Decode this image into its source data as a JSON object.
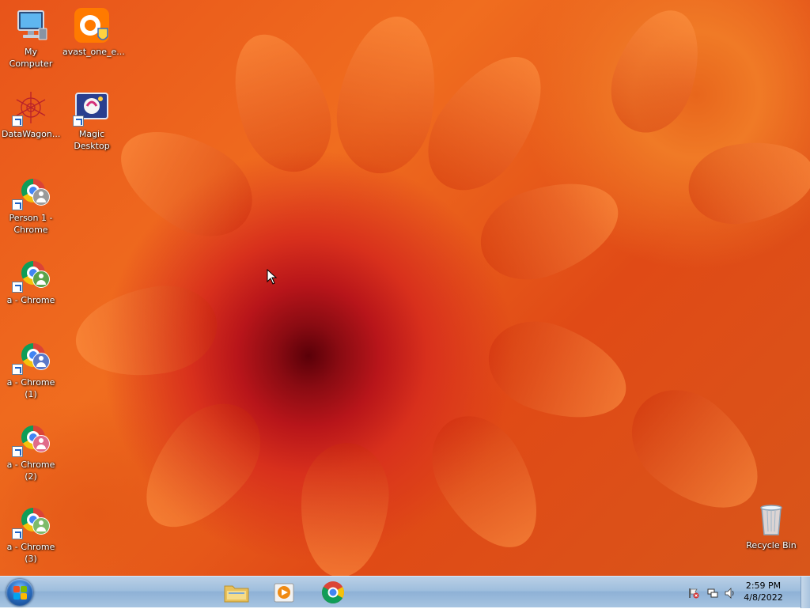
{
  "desktop_icons": [
    {
      "name": "my-computer",
      "label": "My Computer",
      "icon": "monitor-icon"
    },
    {
      "name": "avast-one",
      "label": "avast_one_e...",
      "icon": "avast-icon"
    },
    {
      "name": "datawagon",
      "label": "DataWagon...",
      "icon": "datawagon-icon"
    },
    {
      "name": "magic-desktop",
      "label": "Magic Desktop",
      "icon": "magic-desktop-icon"
    },
    {
      "name": "person1-chrome",
      "label": "Person 1 - Chrome",
      "icon": "chrome-icon"
    },
    {
      "name": "a-chrome",
      "label": "a - Chrome",
      "icon": "chrome-icon"
    },
    {
      "name": "a-chrome-1",
      "label": "a - Chrome (1)",
      "icon": "chrome-icon"
    },
    {
      "name": "a-chrome-2",
      "label": "a - Chrome (2)",
      "icon": "chrome-icon"
    },
    {
      "name": "a-chrome-3",
      "label": "a - Chrome (3)",
      "icon": "chrome-icon"
    },
    {
      "name": "recycle-bin",
      "label": "Recycle Bin",
      "icon": "recycle-bin-icon"
    }
  ],
  "taskbar": {
    "start": {
      "icon": "windows-logo-icon"
    },
    "pinned": [
      {
        "name": "explorer",
        "icon": "folder-icon"
      },
      {
        "name": "media-player",
        "icon": "media-player-icon"
      },
      {
        "name": "chrome",
        "icon": "chrome-icon"
      }
    ],
    "tray": {
      "icons": [
        "action-center-flag-icon",
        "network-icon",
        "volume-icon"
      ],
      "time": "2:59 PM",
      "date": "4/8/2022"
    }
  },
  "colors": {
    "taskbar": "#a7c4e1",
    "badge_gray": "#9a9a9a",
    "badge_green": "#5aa34a",
    "badge_blue": "#5b79c9",
    "badge_pink": "#e06b8a",
    "badge_lightgreen": "#7dbb6a"
  }
}
